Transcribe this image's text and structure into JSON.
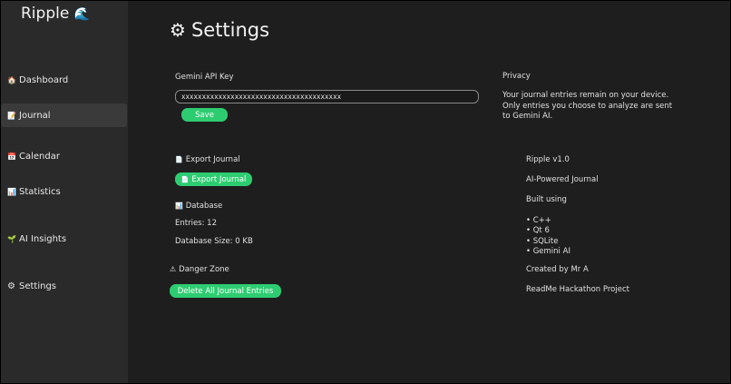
{
  "app": {
    "title": "Ripple",
    "title_icon": "🌊"
  },
  "sidebar": {
    "items": [
      {
        "icon": "🏠",
        "label": "Dashboard"
      },
      {
        "icon": "📝",
        "label": "Journal"
      },
      {
        "icon": "📅",
        "label": "Calendar"
      },
      {
        "icon": "📊",
        "label": "Statistics"
      },
      {
        "icon": "🌱",
        "label": "AI Insights"
      },
      {
        "icon": "⚙",
        "label": "Settings"
      }
    ],
    "active": "Journal"
  },
  "page": {
    "title": "Settings",
    "title_icon": "⚙"
  },
  "api": {
    "label": "Gemini API Key",
    "value": "xxxxxxxxxxxxxxxxxxxxxxxxxxxxxxxxxxxxxxx",
    "save_label": "Save"
  },
  "privacy": {
    "heading": "Privacy",
    "text": "Your journal entries remain on your device. Only entries you choose to analyze are sent to Gemini AI."
  },
  "export": {
    "icon": "📄",
    "heading": "Export Journal",
    "button_icon": "📄",
    "button_label": "Export Journal"
  },
  "database": {
    "icon": "📊",
    "heading": "Database",
    "entries": "Entries: 12",
    "size": "Database Size: 0 KB"
  },
  "danger": {
    "icon": "⚠",
    "heading": "Danger Zone",
    "button_label": "Delete All Journal Entries"
  },
  "about": {
    "version": "Ripple v1.0",
    "tagline": "AI-Powered Journal",
    "built_using": "Built using",
    "tech": [
      "• C++",
      "• Qt 6",
      "• SQLite",
      "• Gemini AI"
    ],
    "credit": "Created by Mr A",
    "project": "ReadMe Hackathon Project"
  },
  "colors": {
    "accent": "#2ecc71",
    "background": "#1e1e1e",
    "sidebar": "#2a2a2a",
    "active_item": "#3a3a3a"
  }
}
